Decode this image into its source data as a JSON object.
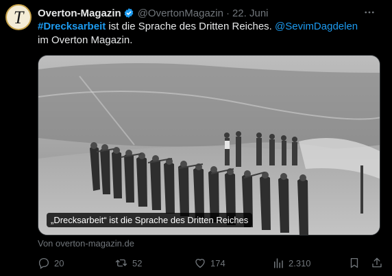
{
  "tweet": {
    "avatar_letter": "T",
    "display_name": "Overton-Magazin",
    "handle": "@OvertonMagazin",
    "separator": "·",
    "date": "22. Juni",
    "text_hashtag": "#Drecksarbeit",
    "text_mid": " ist die Sprache des Dritten Reiches. ",
    "text_mention": "@SevimDagdelen",
    "text_end": " im Overton Magazin."
  },
  "media": {
    "caption": "„Drecksarbeit“ ist die Sprache des Dritten Reiches"
  },
  "source": "Von overton-magazin.de",
  "actions": {
    "replies": "20",
    "retweets": "52",
    "likes": "174",
    "views": "2.310"
  },
  "colors": {
    "background": "#000000",
    "text": "#e7e9ea",
    "muted": "#71767b",
    "accent": "#1d9bf0"
  },
  "icons": {
    "verified": "verified-badge-icon",
    "more": "more-horizontal-icon",
    "reply": "reply-icon",
    "retweet": "retweet-icon",
    "like": "heart-icon",
    "views": "views-icon",
    "bookmark": "bookmark-icon",
    "share": "share-icon"
  }
}
